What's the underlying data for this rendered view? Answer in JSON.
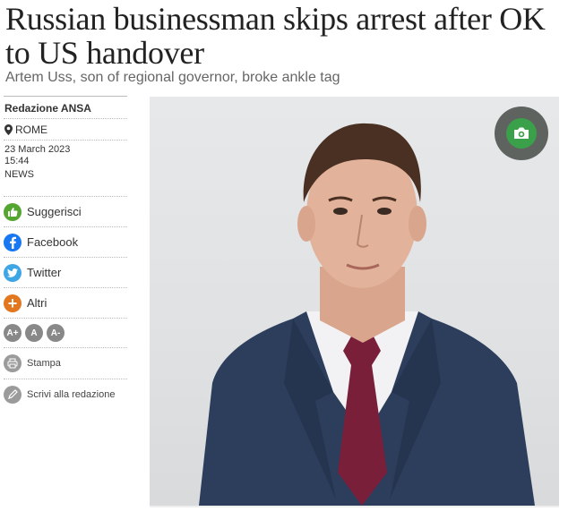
{
  "article": {
    "headline": "Russian businessman skips arrest after OK to US handover",
    "subtitle": "Artem Uss, son of regional governor, broke ankle tag"
  },
  "sidebar": {
    "author": "Redazione ANSA",
    "location": "ROME",
    "date": "23 March 2023",
    "time": "15:44",
    "category": "NEWS",
    "share": {
      "suggest": "Suggerisci",
      "facebook": "Facebook",
      "twitter": "Twitter",
      "more": "Altri"
    },
    "font_controls": [
      "A+",
      "A",
      "A-"
    ],
    "print": "Stampa",
    "write": "Scrivi alla redazione"
  },
  "icons": {
    "location": "map-pin-icon",
    "suggest": "thumbs-up-icon",
    "facebook": "facebook-icon",
    "twitter": "twitter-bird-icon",
    "more": "plus-icon",
    "print": "printer-icon",
    "write": "pen-icon",
    "photo": "camera-icon"
  },
  "colors": {
    "suggest": "#55a531",
    "facebook": "#1877f2",
    "twitter": "#3fa6e6",
    "more": "#e2771f",
    "photo_button": "#3aa14a"
  }
}
